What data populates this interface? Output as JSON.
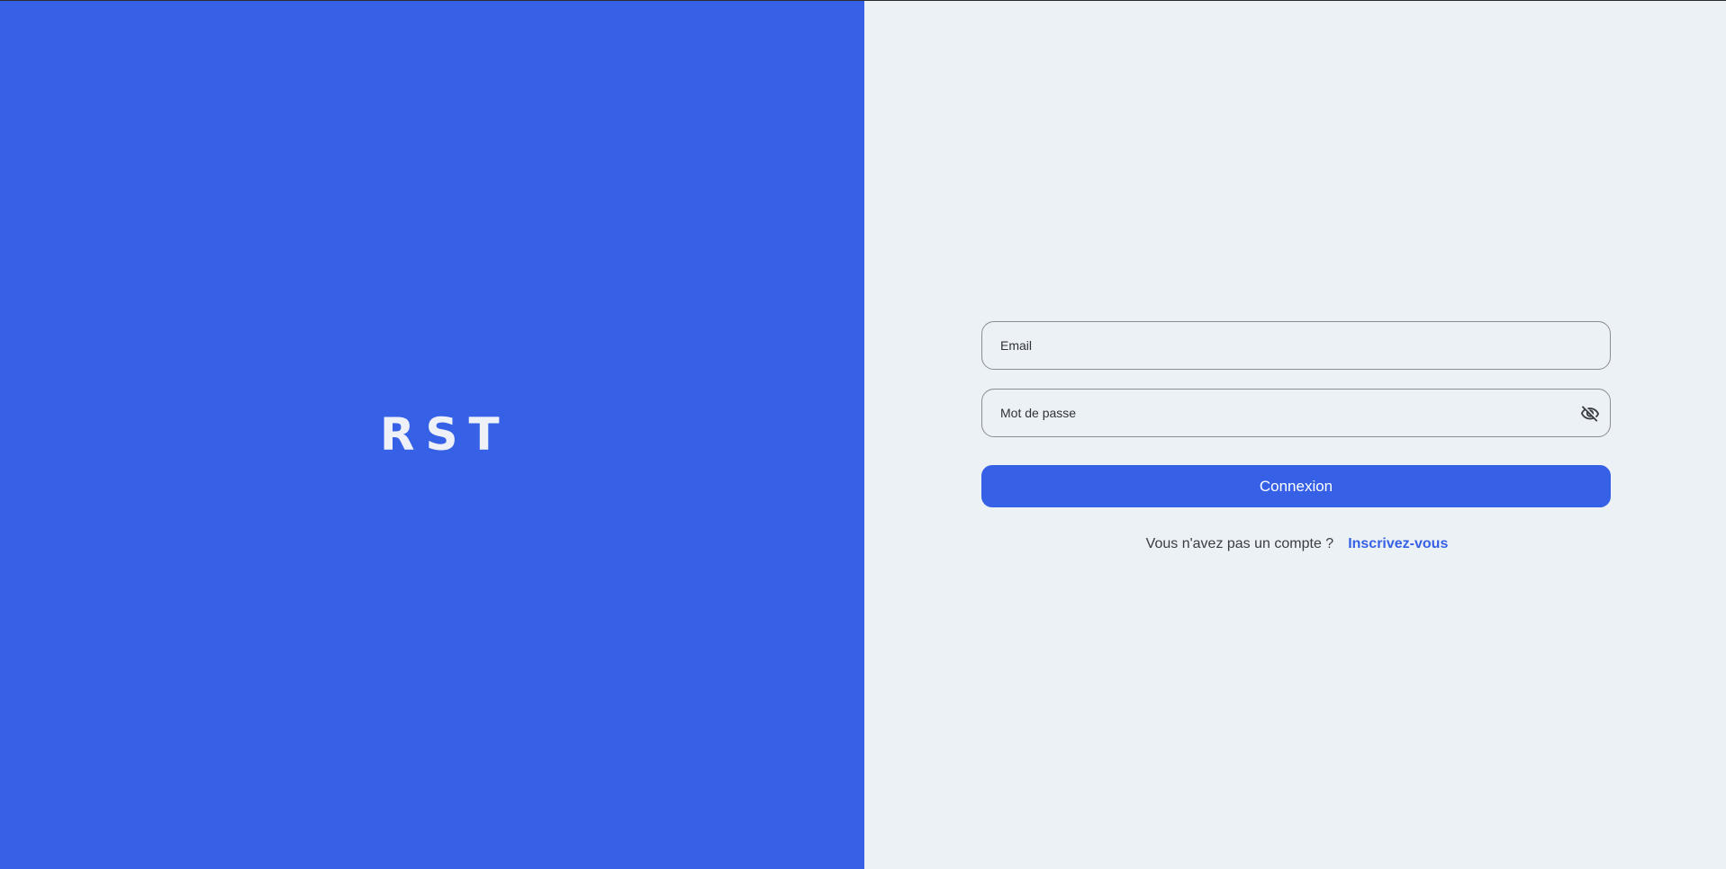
{
  "brand": {
    "logo_text": "RST",
    "panel_color": "#3661e6"
  },
  "login_form": {
    "email_placeholder": "Email",
    "email_value": "",
    "password_placeholder": "Mot de passe",
    "password_value": "",
    "password_toggle_icon": "eye-off-icon",
    "submit_label": "Connexion",
    "signup_prompt": "Vous n'avez pas un compte ?",
    "signup_link_label": "Inscrivez-vous"
  },
  "colors": {
    "accent": "#3661e6",
    "form_background": "#ecf1f5"
  }
}
